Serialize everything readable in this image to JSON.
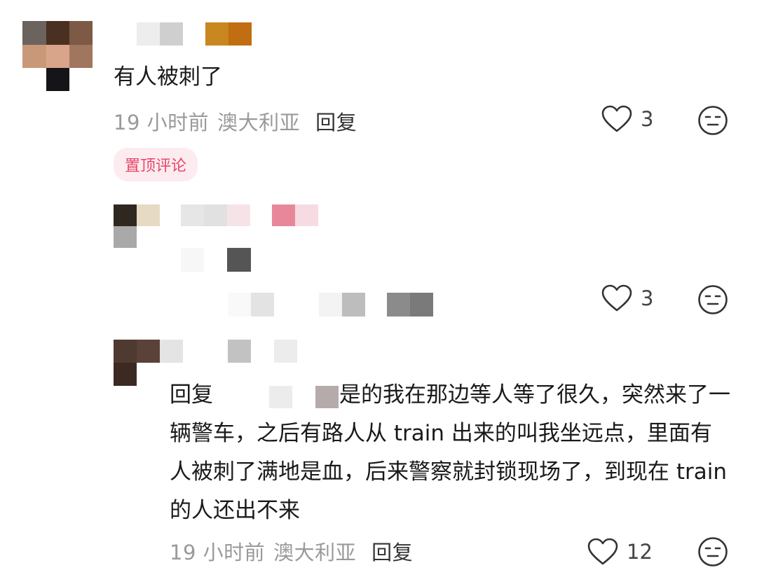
{
  "comments": [
    {
      "text": "有人被刺了",
      "time": "19 小时前",
      "region": "澳大利亚",
      "reply_label": "回复",
      "likes": "3",
      "pinned_badge": "置顶评论",
      "icons": [
        "heart-icon",
        "neutral-face-icon"
      ]
    },
    {
      "likes": "3",
      "icons": [
        "heart-icon",
        "neutral-face-icon"
      ]
    },
    {
      "reply_prefix": "回复",
      "text": "是的我在那边等人等了很久，突然来了一辆警车，之后有路人从 train 出来的叫我坐远点，里面有人被刺了满地是血，后来警察就封锁现场了，到现在 train 的人还出不来",
      "time": "19 小时前",
      "region": "澳大利亚",
      "reply_label": "回复",
      "likes": "12",
      "icons": [
        "heart-icon",
        "neutral-face-icon"
      ]
    }
  ],
  "colors": {
    "meta_gray": "#9a9a9a",
    "pin_badge_bg": "#fdecef",
    "pin_badge_text": "#e6476a"
  }
}
